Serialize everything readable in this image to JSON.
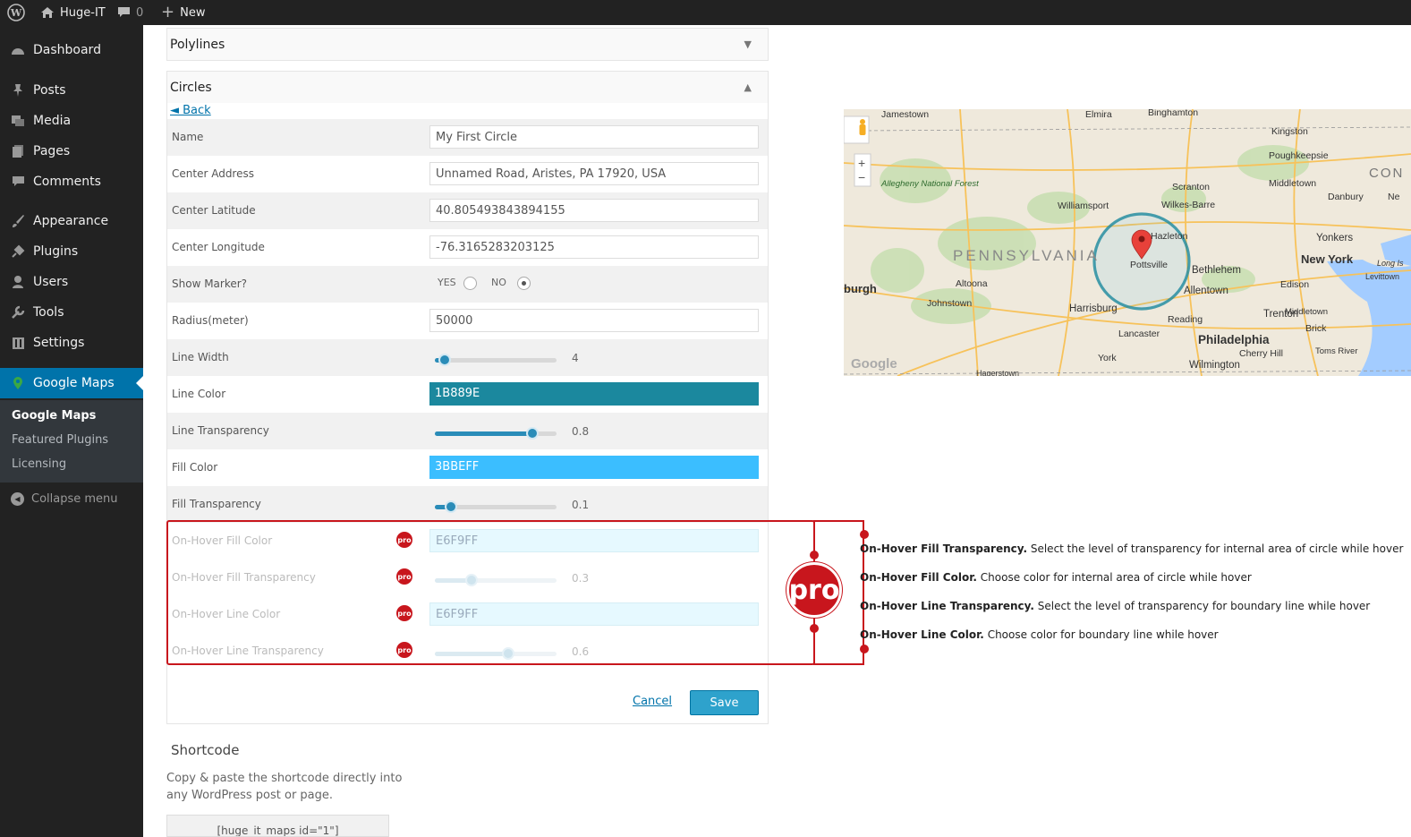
{
  "adminbar": {
    "site_name": "Huge-IT",
    "comments_count": "0",
    "new_label": "New"
  },
  "sidebar": {
    "items": [
      {
        "label": "Dashboard"
      },
      {
        "label": "Posts"
      },
      {
        "label": "Media"
      },
      {
        "label": "Pages"
      },
      {
        "label": "Comments"
      },
      {
        "label": "Appearance"
      },
      {
        "label": "Plugins"
      },
      {
        "label": "Users"
      },
      {
        "label": "Tools"
      },
      {
        "label": "Settings"
      },
      {
        "label": "Google Maps"
      }
    ],
    "submenu": [
      "Google Maps",
      "Featured Plugins",
      "Licensing"
    ],
    "collapse_label": "Collapse menu"
  },
  "panels": {
    "polylines": "Polylines",
    "circles": "Circles"
  },
  "back_label": "◄ Back",
  "form": {
    "name": {
      "label": "Name",
      "value": "My First Circle"
    },
    "center_address": {
      "label": "Center Address",
      "value": "Unnamed Road, Aristes, PA 17920, USA"
    },
    "center_latitude": {
      "label": "Center Latitude",
      "value": "40.805493843894155"
    },
    "center_longitude": {
      "label": "Center Longitude",
      "value": "-76.3165283203125"
    },
    "show_marker": {
      "label": "Show Marker?",
      "yes": "YES",
      "no": "NO",
      "selected": "NO"
    },
    "radius": {
      "label": "Radius(meter)",
      "value": "50000"
    },
    "line_width": {
      "label": "Line Width",
      "value": "4",
      "fraction": 0.08
    },
    "line_color": {
      "label": "Line Color",
      "value": "1B889E",
      "color": "#1B889E"
    },
    "line_transparency": {
      "label": "Line Transparency",
      "value": "0.8",
      "fraction": 0.8
    },
    "fill_color": {
      "label": "Fill Color",
      "value": "3BBEFF",
      "color": "#3BBEFF"
    },
    "fill_transparency": {
      "label": "Fill Transparency",
      "value": "0.1",
      "fraction": 0.13
    },
    "hover_fill_color": {
      "label": "On-Hover Fill Color",
      "value": "E6F9FF",
      "color": "#E6F9FF"
    },
    "hover_fill_transparency": {
      "label": "On-Hover Fill Transparency",
      "value": "0.3",
      "fraction": 0.3
    },
    "hover_line_color": {
      "label": "On-Hover Line Color",
      "value": "E6F9FF",
      "color": "#E6F9FF"
    },
    "hover_line_transparency": {
      "label": "On-Hover Line Transparency",
      "value": "0.6",
      "fraction": 0.6
    }
  },
  "pro_badge": "pro",
  "actions": {
    "cancel": "Cancel",
    "save": "Save"
  },
  "shortcode": {
    "title": "Shortcode",
    "description": "Copy & paste the shortcode directly into any WordPress post or page.",
    "code": "[huge_it_maps id=\"1\"]"
  },
  "map": {
    "state_label": "PENNSYLVANIA",
    "cities": [
      "Jamestown",
      "Elmira",
      "Binghamton",
      "Kingston",
      "Poughkeepsie",
      "Scranton",
      "Middletown",
      "Danbury",
      "Williamsport",
      "Wilkes-Barre",
      "Hazleton",
      "Pottsville",
      "Bethlehem",
      "Allentown",
      "Yonkers",
      "New York",
      "Long Is",
      "Levittown",
      "Altoona",
      "Johnstown",
      "Harrisburg",
      "Reading",
      "Edison",
      "Trenton",
      "Middletown",
      "Lancaster",
      "Philadelphia",
      "Brick",
      "York",
      "Cherry Hill",
      "Toms River",
      "Wilmington",
      "Hagerstown",
      "Allegheny National Forest",
      "burgh",
      "CON",
      "Ne"
    ],
    "google_logo": "Google",
    "zoom_in": "+",
    "zoom_out": "−"
  },
  "pro_notes": [
    {
      "title": "On-Hover Fill Transparency.",
      "text": " Select the level of transparency for internal area of circle while hover"
    },
    {
      "title": "On-Hover Fill Color.",
      "text": " Choose color for internal area of circle while hover"
    },
    {
      "title": "On-Hover Line Transparency.",
      "text": " Select the level of transparency for boundary line while hover"
    },
    {
      "title": "On-Hover Line Color.",
      "text": " Choose color for boundary line while hover"
    }
  ],
  "colors": {
    "accent": "#0073aa",
    "pro_red": "#c8161d",
    "save_blue": "#2ea2cc"
  }
}
